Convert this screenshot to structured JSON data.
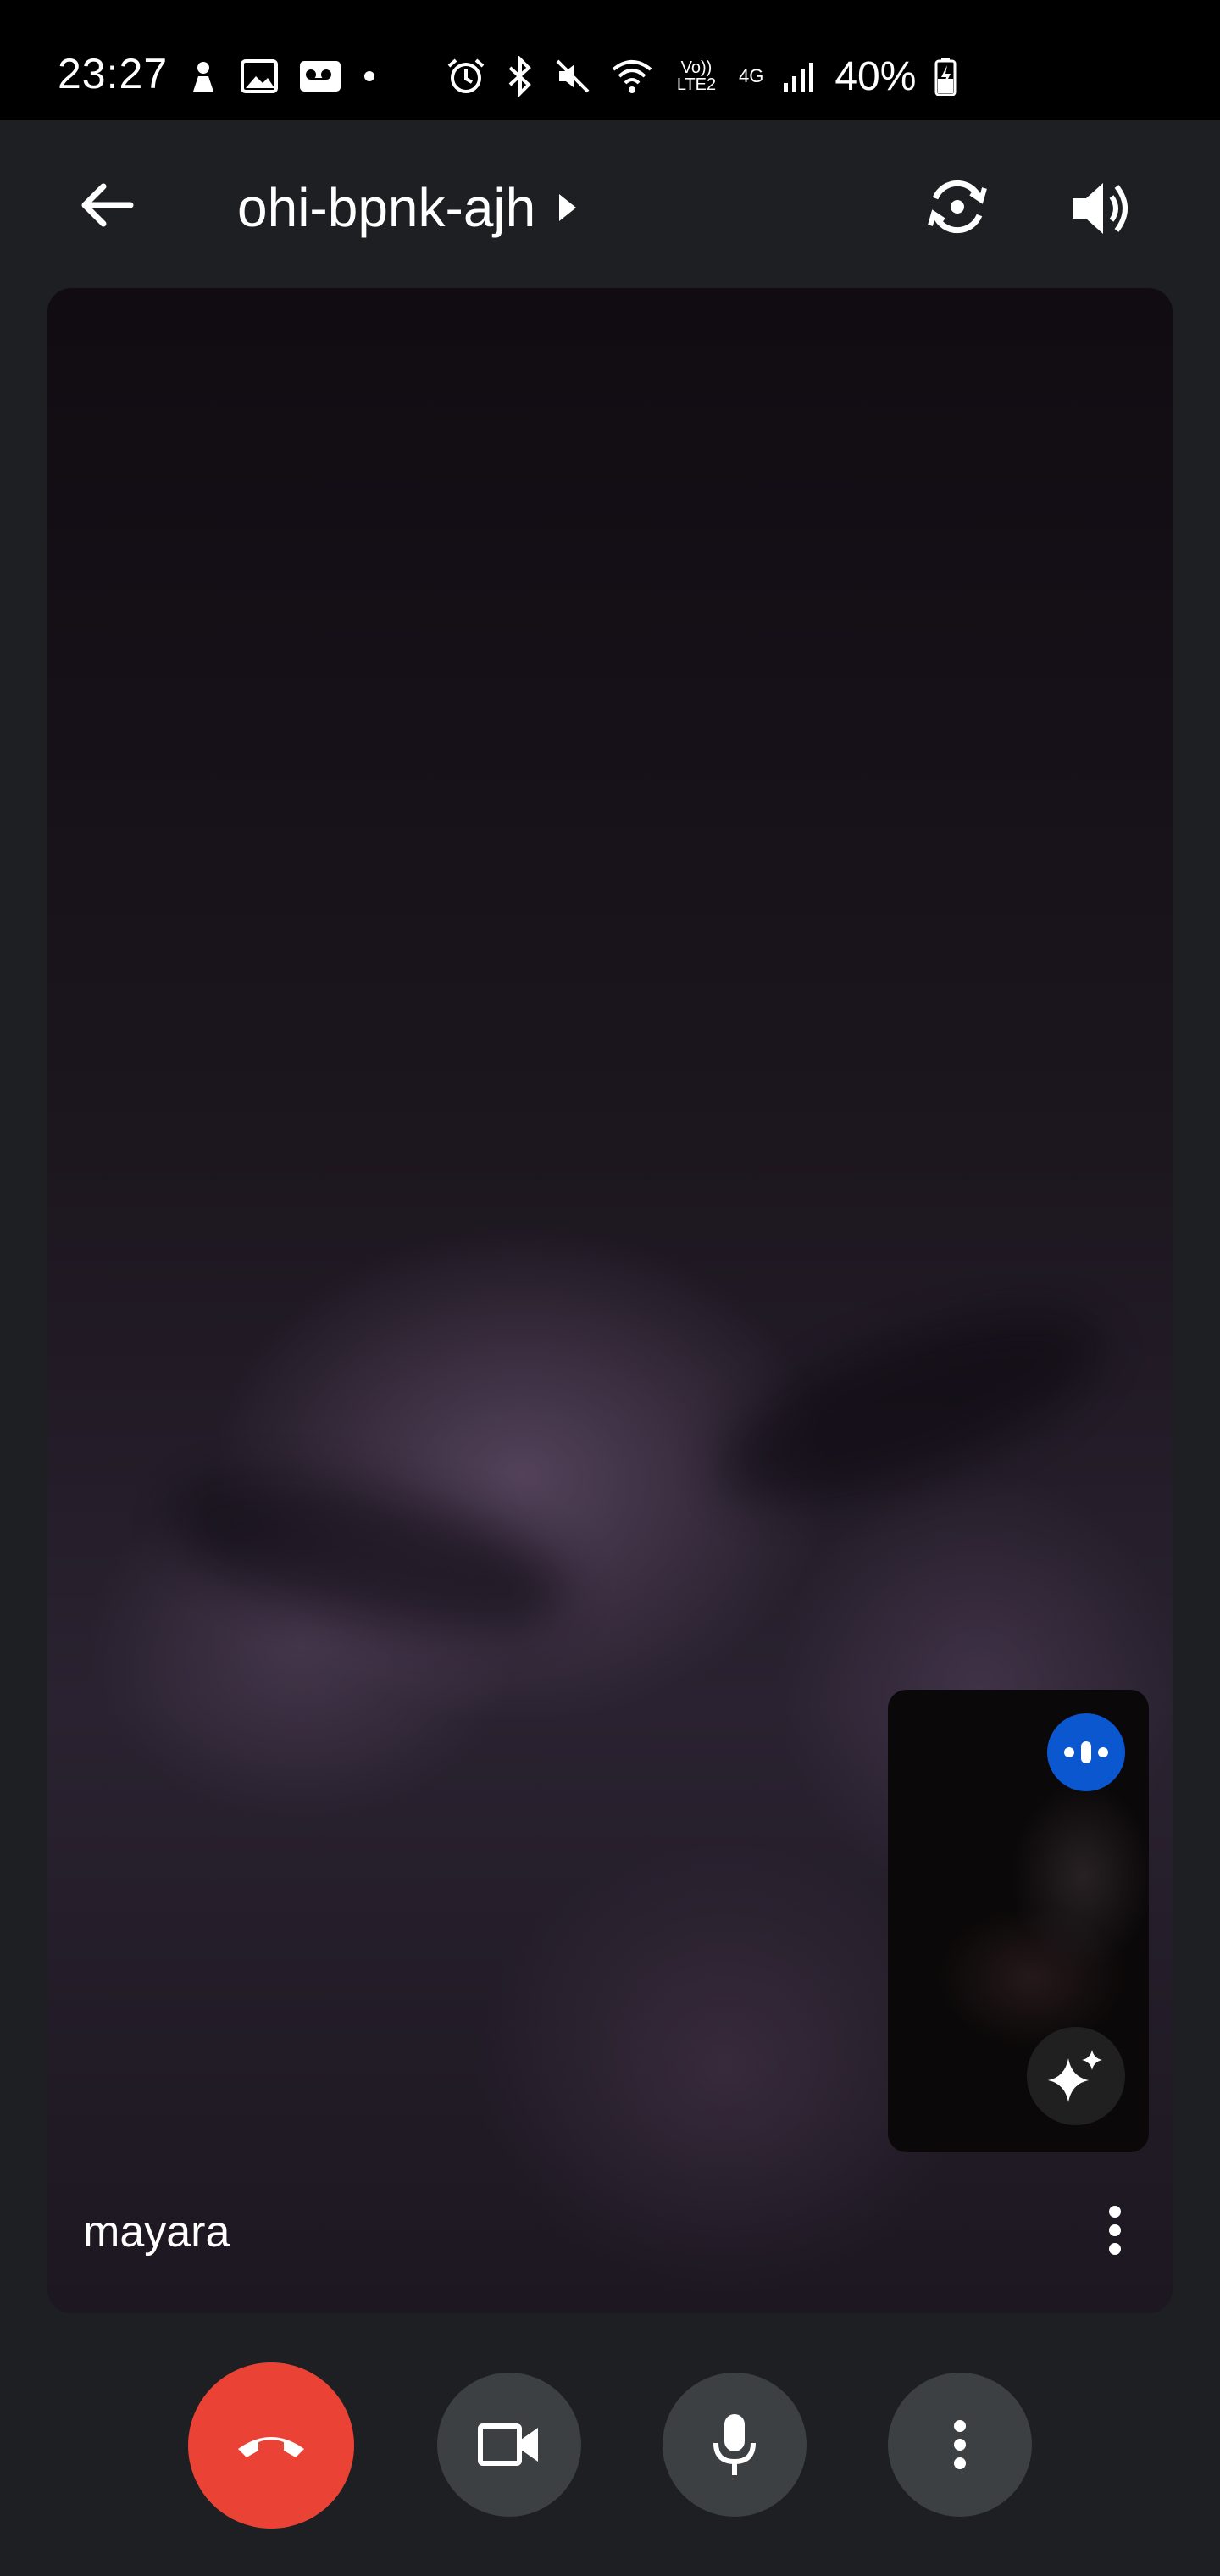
{
  "status_bar": {
    "time": "23:27",
    "volte_label": "Vo))\nLTE2",
    "network": "4G",
    "battery": "40%"
  },
  "app_bar": {
    "meeting_code": "ohi-bpnk-ajh",
    "icons": [
      "back-arrow-icon",
      "chevron-right-icon",
      "switch-camera-icon",
      "speaker-icon"
    ]
  },
  "video": {
    "participant_name": "mayara"
  },
  "controls": {
    "icons": [
      "end-call-icon",
      "camera-icon",
      "microphone-icon",
      "more-vert-icon"
    ],
    "end_call_color": "#ea4335",
    "control_color": "#3c4043"
  },
  "self_view": {
    "speaking_indicator_color": "#0b57d0",
    "icons": [
      "speaking-icon",
      "sparkle-effects-icon"
    ]
  }
}
